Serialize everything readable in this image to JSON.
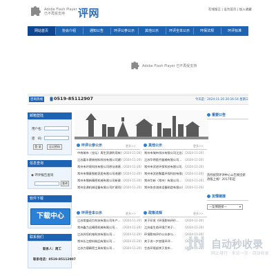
{
  "header": {
    "flash_message": "Adobe Flash Player 已不再受支持",
    "logo_text": "评网",
    "top_links": "在线留言 | 设为首页 | 加入收藏"
  },
  "nav": {
    "items": [
      "网站首页",
      "协会介绍",
      "通知公告",
      "环评公参公示",
      "其他公示",
      "环评全本公示",
      "环保法规",
      "环评标准"
    ],
    "active_index": 0
  },
  "banner": {
    "flash_message": "Adobe Flash Player 已不再受支持"
  },
  "hotline": {
    "label": "咨询热线",
    "number": "0519-85112907",
    "today": "今天是：2024-11-20 20:16:54 星期三"
  },
  "left": {
    "login": {
      "title": "邮箱登陆",
      "username_label": "用户名：",
      "password_label": "密　码：",
      "login_button": "登 录",
      "forgot_button": "忘记密码"
    },
    "query": {
      "title": "信息查询",
      "option": "环评报告查询",
      "query_button": "查询"
    },
    "download": {
      "title": "软件下载",
      "button": "下载中心"
    },
    "contact": {
      "title": "联系我们",
      "person": "联系人：周工",
      "phone": "联系电话：0519-85112907"
    }
  },
  "center": {
    "sections": [
      {
        "title": "环评公参公示",
        "more": "更多>>",
        "items": [
          {
            "title": "中南城市（金坛）再生资源利用有限公...",
            "date": "[2024-11-20]"
          },
          {
            "title": "江苏嘉丰建筑材料科技有限公司建设项...",
            "date": "[2024-11-20]"
          },
          {
            "title": "常州市环境科技有限公司原址改建...",
            "date": "[2024-11-20]"
          },
          {
            "title": "常州市鼎泰智能家居有限公司改建项目...",
            "date": "[2024-11-20]"
          },
          {
            "title": "常州市鼎新精密机械有限公司新建...",
            "date": "[2024-11-20]"
          },
          {
            "title": "常州金源机械设备有限公司扩建项目...",
            "date": "[2024-11-20]"
          }
        ]
      },
      {
        "title": "其他公示",
        "more": "更多>>",
        "items": [
          {
            "title": "常州市城市排水有限公司江边污...",
            "date": "[2024-11-20]"
          },
          {
            "title": "江苏华明医疗器械有限公司...",
            "date": "[2024-11-20]"
          },
          {
            "title": "常州市武进环保科技有限公司...",
            "date": "[2024-11-20]"
          },
          {
            "title": "常州市武进聚嘉环保科技有限公司...",
            "date": "[2024-11-20]"
          },
          {
            "title": "常州华新（常州）有限公司...",
            "date": "[2024-11-20]"
          },
          {
            "title": "常州协合流体设备制造有限公司...",
            "date": "[2024-11-20]"
          }
        ]
      },
      {
        "title": "环评全本公示",
        "more": "更多>>",
        "items": [
          {
            "title": "江苏常盛动力科技有限公司年产...",
            "date": "[2024-11-20]"
          },
          {
            "title": "常州鑫力达精密机械有限公司...",
            "date": "[2024-11-20]"
          },
          {
            "title": "江苏苏恒机电科技有限公司...",
            "date": "[2024-11-20]"
          },
          {
            "title": "常州长江塑料制品有限公司...",
            "date": "[2024-11-20]"
          },
          {
            "title": "江苏力德精密工具有限公司...",
            "date": "[2024-11-20]"
          }
        ]
      },
      {
        "title": "政策法规",
        "more": "更多>>",
        "items": [
          {
            "title": "关于印发《环境影响评价...",
            "date": "[2024-11-20]"
          },
          {
            "title": "江苏省生态环境厅关于...",
            "date": "[2024-11-20]"
          },
          {
            "title": "环境影响评价公众参与...",
            "date": "[2024-11-20]"
          },
          {
            "title": "关于进一步加强环评...",
            "date": "[2024-11-20]"
          },
          {
            "title": "生态环境部关于发布...",
            "date": "[2024-11-20]"
          }
        ]
      }
    ]
  },
  "right": {
    "notice": {
      "title": "重要公告",
      "text": "热烈祝贺环评中心公告网全新改版上线！2017年起"
    },
    "links": {
      "title": "友情链接",
      "select_placeholder": "—友情链接—"
    }
  },
  "watermark": {
    "text": "自动秒收录",
    "sub": "网上排行 · 来访一次 · 自动收录"
  }
}
